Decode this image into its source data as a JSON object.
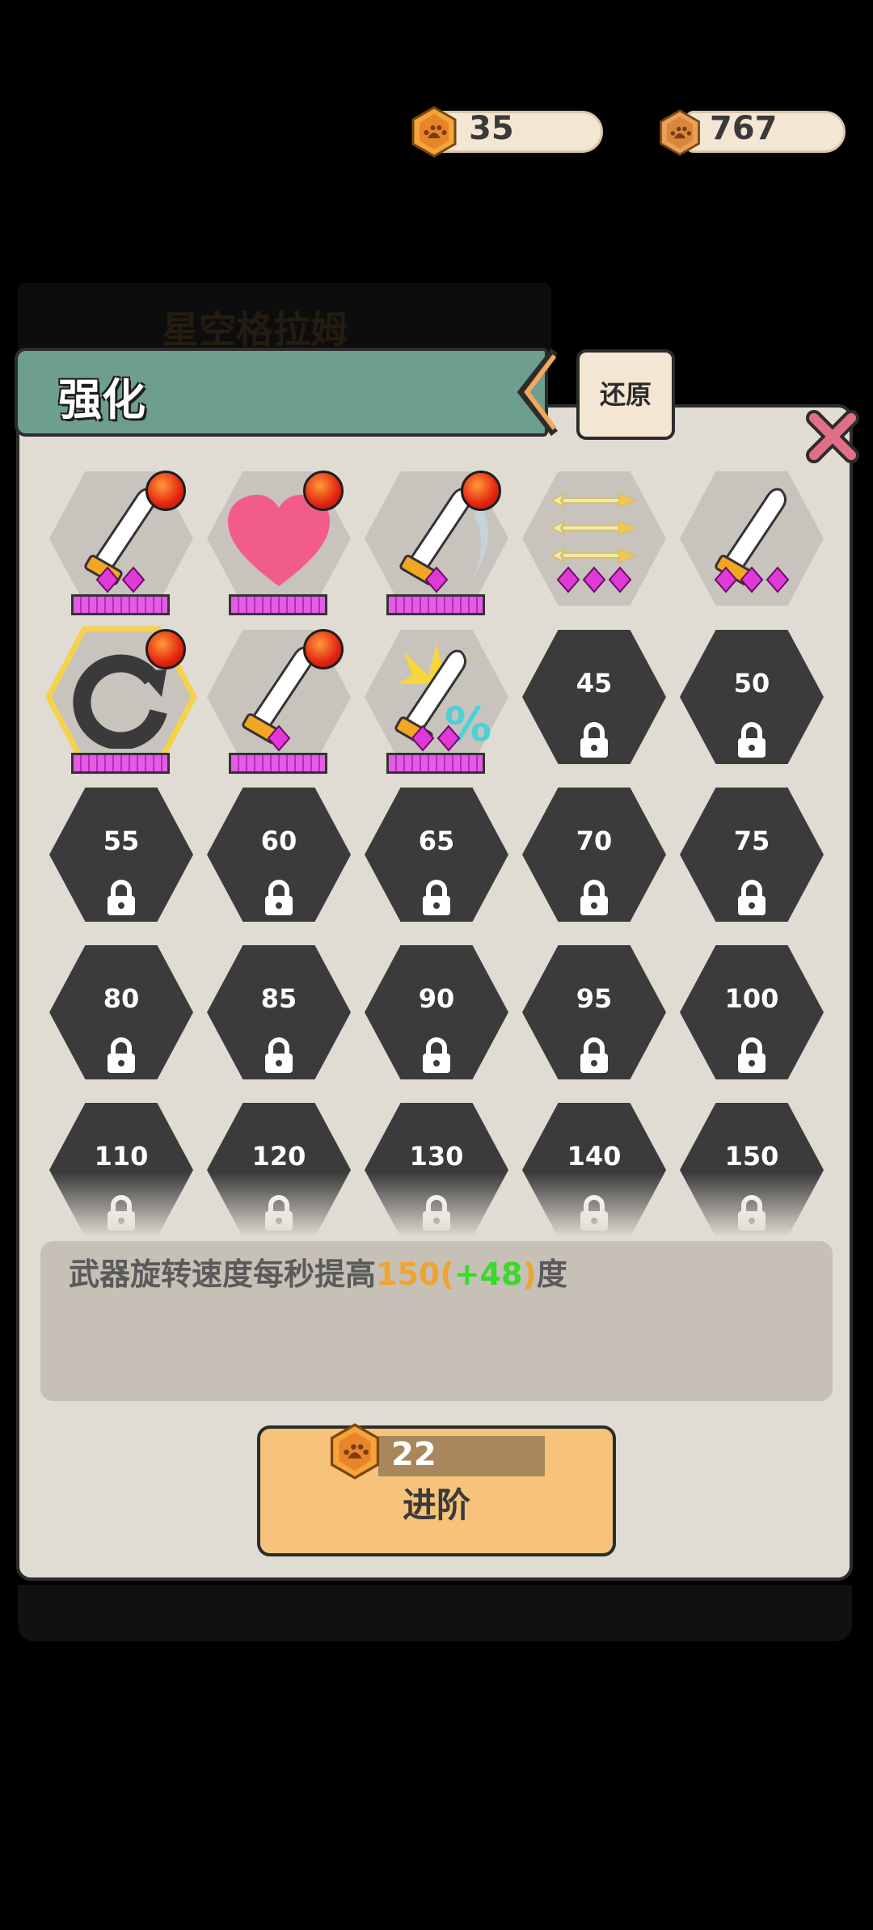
{
  "currency": {
    "primary": "35",
    "secondary": "767"
  },
  "background_title": "星空格拉姆",
  "header": {
    "title": "强化",
    "restore_label": "还原"
  },
  "grid": {
    "unlocked_count": 8,
    "locked_levels": [
      "45",
      "50",
      "55",
      "60",
      "65",
      "70",
      "75",
      "80",
      "85",
      "90",
      "95",
      "100",
      "110",
      "120",
      "130",
      "140",
      "150"
    ]
  },
  "description": {
    "prefix": "武器旋转速度每秒提高",
    "value": "150",
    "open": "(",
    "bonus": "+48",
    "close": ")",
    "suffix": "度"
  },
  "advance": {
    "cost": "22",
    "label": "进阶"
  },
  "colors": {
    "panel": "#e0dbd3",
    "header": "#6d9e8e",
    "locked_hex": "#3b3b3b",
    "button": "#f7c37a",
    "highlight": "#f0a330",
    "bonus": "#3bd82d"
  }
}
